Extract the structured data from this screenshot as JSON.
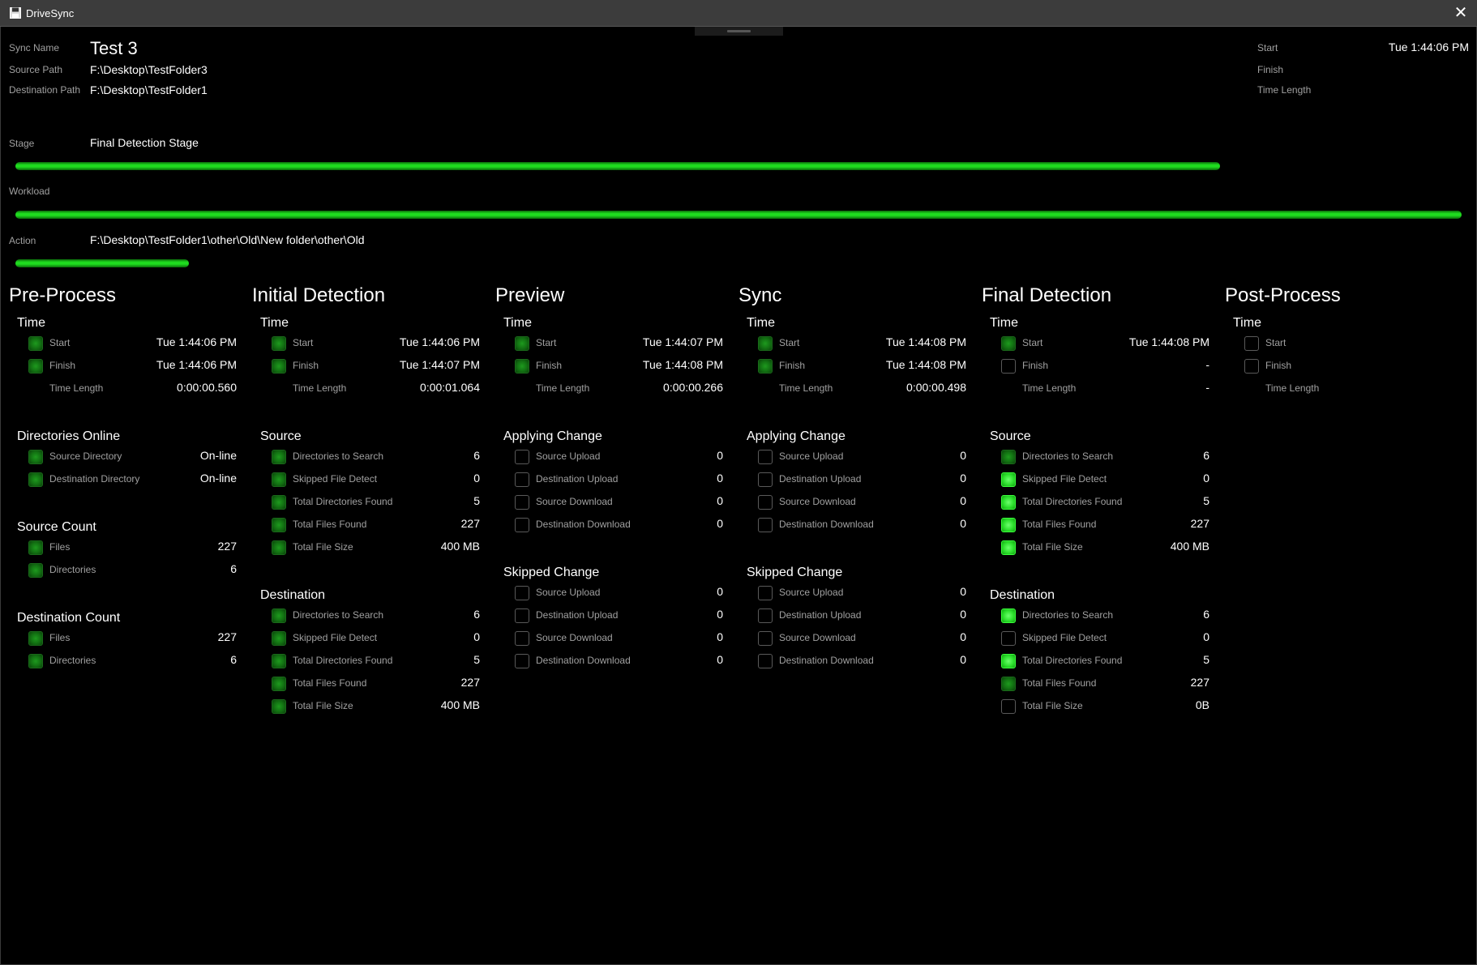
{
  "window": {
    "title": "DriveSync",
    "close_label": "✕"
  },
  "header": {
    "sync_name_label": "Sync Name",
    "sync_name": "Test 3",
    "source_path_label": "Source Path",
    "source_path": "F:\\Desktop\\TestFolder3",
    "dest_path_label": "Destination Path",
    "dest_path": "F:\\Desktop\\TestFolder1",
    "start_label": "Start",
    "start_value": "Tue 1:44:06 PM",
    "finish_label": "Finish",
    "finish_value": "",
    "time_length_label": "Time Length",
    "time_length_value": ""
  },
  "progress": {
    "stage_label": "Stage",
    "stage_value": "Final Detection Stage",
    "stage_fraction": 0.833,
    "workload_label": "Workload",
    "workload_value": "",
    "workload_fraction": 1.0,
    "action_label": "Action",
    "action_value": "F:\\Desktop\\TestFolder1\\other\\Old\\New folder\\other\\Old",
    "action_fraction": 0.12
  },
  "colors": {
    "led_dim": "#127012",
    "led_bright": "#2de02d",
    "bar": "#1fdc1f"
  },
  "columns": [
    {
      "title": "Pre-Process",
      "sections": [
        {
          "title": "Time",
          "rows": [
            {
              "label": "Start",
              "value": "Tue 1:44:06 PM",
              "led": "dim"
            },
            {
              "label": "Finish",
              "value": "Tue 1:44:06 PM",
              "led": "dim"
            },
            {
              "label": "Time Length",
              "value": "0:00:00.560",
              "led": "none"
            }
          ]
        },
        {
          "title": "Directories Online",
          "rows": [
            {
              "label": "Source Directory",
              "value": "On-line",
              "led": "dim"
            },
            {
              "label": "Destination Directory",
              "value": "On-line",
              "led": "dim"
            }
          ]
        },
        {
          "title": "Source Count",
          "rows": [
            {
              "label": "Files",
              "value": "227",
              "led": "dim"
            },
            {
              "label": "Directories",
              "value": "6",
              "led": "dim"
            }
          ]
        },
        {
          "title": "Destination Count",
          "rows": [
            {
              "label": "Files",
              "value": "227",
              "led": "dim"
            },
            {
              "label": "Directories",
              "value": "6",
              "led": "dim"
            }
          ]
        }
      ]
    },
    {
      "title": "Initial Detection",
      "sections": [
        {
          "title": "Time",
          "rows": [
            {
              "label": "Start",
              "value": "Tue 1:44:06 PM",
              "led": "dim"
            },
            {
              "label": "Finish",
              "value": "Tue 1:44:07 PM",
              "led": "dim"
            },
            {
              "label": "Time Length",
              "value": "0:00:01.064",
              "led": "none"
            }
          ]
        },
        {
          "title": "Source",
          "rows": [
            {
              "label": "Directories to Search",
              "value": "6",
              "led": "dim"
            },
            {
              "label": "Skipped File Detect",
              "value": "0",
              "led": "dim"
            },
            {
              "label": "Total Directories Found",
              "value": "5",
              "led": "dim"
            },
            {
              "label": "Total Files Found",
              "value": "227",
              "led": "dim"
            },
            {
              "label": "Total File Size",
              "value": "400 MB",
              "led": "dim"
            }
          ]
        },
        {
          "title": "Destination",
          "rows": [
            {
              "label": "Directories to Search",
              "value": "6",
              "led": "dim"
            },
            {
              "label": "Skipped File Detect",
              "value": "0",
              "led": "dim"
            },
            {
              "label": "Total Directories Found",
              "value": "5",
              "led": "dim"
            },
            {
              "label": "Total Files Found",
              "value": "227",
              "led": "dim"
            },
            {
              "label": "Total File Size",
              "value": "400 MB",
              "led": "dim"
            }
          ]
        }
      ]
    },
    {
      "title": "Preview",
      "sections": [
        {
          "title": "Time",
          "rows": [
            {
              "label": "Start",
              "value": "Tue 1:44:07 PM",
              "led": "dim"
            },
            {
              "label": "Finish",
              "value": "Tue 1:44:08 PM",
              "led": "dim"
            },
            {
              "label": "Time Length",
              "value": "0:00:00.266",
              "led": "none"
            }
          ]
        },
        {
          "title": "Applying Change",
          "rows": [
            {
              "label": "Source Upload",
              "value": "0",
              "led": "off"
            },
            {
              "label": "Destination Upload",
              "value": "0",
              "led": "off"
            },
            {
              "label": "Source Download",
              "value": "0",
              "led": "off"
            },
            {
              "label": "Destination Download",
              "value": "0",
              "led": "off"
            }
          ]
        },
        {
          "title": "Skipped Change",
          "rows": [
            {
              "label": "Source Upload",
              "value": "0",
              "led": "off"
            },
            {
              "label": "Destination Upload",
              "value": "0",
              "led": "off"
            },
            {
              "label": "Source Download",
              "value": "0",
              "led": "off"
            },
            {
              "label": "Destination Download",
              "value": "0",
              "led": "off"
            }
          ]
        }
      ]
    },
    {
      "title": "Sync",
      "sections": [
        {
          "title": "Time",
          "rows": [
            {
              "label": "Start",
              "value": "Tue 1:44:08 PM",
              "led": "dim"
            },
            {
              "label": "Finish",
              "value": "Tue 1:44:08 PM",
              "led": "dim"
            },
            {
              "label": "Time Length",
              "value": "0:00:00.498",
              "led": "none"
            }
          ]
        },
        {
          "title": "Applying Change",
          "rows": [
            {
              "label": "Source Upload",
              "value": "0",
              "led": "off"
            },
            {
              "label": "Destination Upload",
              "value": "0",
              "led": "off"
            },
            {
              "label": "Source Download",
              "value": "0",
              "led": "off"
            },
            {
              "label": "Destination Download",
              "value": "0",
              "led": "off"
            }
          ]
        },
        {
          "title": "Skipped Change",
          "rows": [
            {
              "label": "Source Upload",
              "value": "0",
              "led": "off"
            },
            {
              "label": "Destination Upload",
              "value": "0",
              "led": "off"
            },
            {
              "label": "Source Download",
              "value": "0",
              "led": "off"
            },
            {
              "label": "Destination Download",
              "value": "0",
              "led": "off"
            }
          ]
        }
      ]
    },
    {
      "title": "Final Detection",
      "sections": [
        {
          "title": "Time",
          "rows": [
            {
              "label": "Start",
              "value": "Tue 1:44:08 PM",
              "led": "dim"
            },
            {
              "label": "Finish",
              "value": "-",
              "led": "off"
            },
            {
              "label": "Time Length",
              "value": "-",
              "led": "none"
            }
          ]
        },
        {
          "title": "Source",
          "rows": [
            {
              "label": "Directories to Search",
              "value": "6",
              "led": "dim"
            },
            {
              "label": "Skipped File Detect",
              "value": "0",
              "led": "bright"
            },
            {
              "label": "Total Directories Found",
              "value": "5",
              "led": "bright"
            },
            {
              "label": "Total Files Found",
              "value": "227",
              "led": "bright"
            },
            {
              "label": "Total File Size",
              "value": "400 MB",
              "led": "bright"
            }
          ]
        },
        {
          "title": "Destination",
          "rows": [
            {
              "label": "Directories to Search",
              "value": "6",
              "led": "bright"
            },
            {
              "label": "Skipped File Detect",
              "value": "0",
              "led": "off"
            },
            {
              "label": "Total Directories Found",
              "value": "5",
              "led": "bright"
            },
            {
              "label": "Total Files Found",
              "value": "227",
              "led": "dim"
            },
            {
              "label": "Total File Size",
              "value": "0B",
              "led": "off"
            }
          ]
        }
      ]
    },
    {
      "title": "Post-Process",
      "sections": [
        {
          "title": "Time",
          "rows": [
            {
              "label": "Start",
              "value": "",
              "led": "off"
            },
            {
              "label": "Finish",
              "value": "",
              "led": "off"
            },
            {
              "label": "Time Length",
              "value": "",
              "led": "none"
            }
          ]
        }
      ]
    }
  ]
}
